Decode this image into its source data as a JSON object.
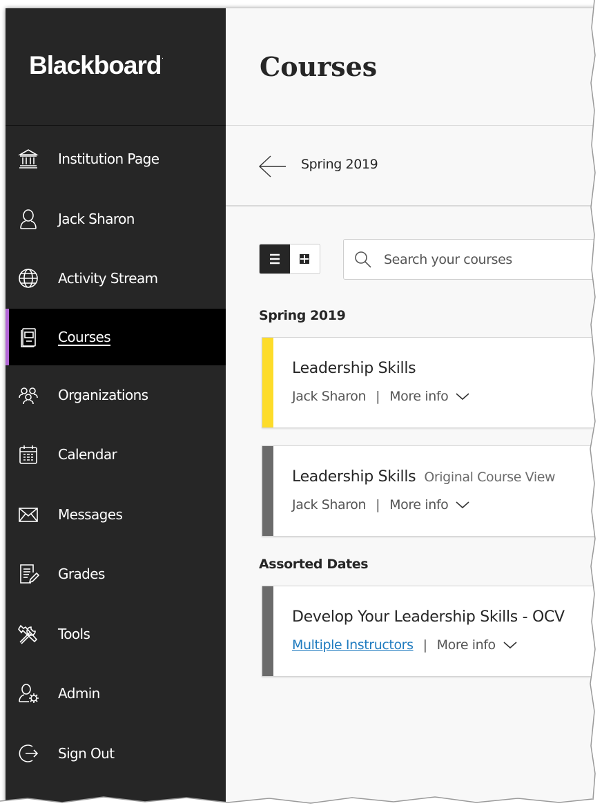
{
  "app": {
    "brand": "Blackboard",
    "trademark": "."
  },
  "colors": {
    "sidebar_bg": "#262626",
    "active_accent": "#b367d6",
    "link": "#1f7bbf",
    "stripe_yellow": "#fddc2a",
    "stripe_gray": "#6b6b6b"
  },
  "sidebar": {
    "items": [
      {
        "label": "Institution Page",
        "icon": "institution-icon"
      },
      {
        "label": "Jack Sharon",
        "icon": "user-icon"
      },
      {
        "label": "Activity Stream",
        "icon": "globe-icon"
      },
      {
        "label": "Courses",
        "icon": "courses-icon",
        "active": true
      },
      {
        "label": "Organizations",
        "icon": "organizations-icon"
      },
      {
        "label": "Calendar",
        "icon": "calendar-icon"
      },
      {
        "label": "Messages",
        "icon": "envelope-icon"
      },
      {
        "label": "Grades",
        "icon": "grades-icon"
      },
      {
        "label": "Tools",
        "icon": "tools-icon"
      },
      {
        "label": "Admin",
        "icon": "admin-icon"
      },
      {
        "label": "Sign Out",
        "icon": "sign-out-icon"
      }
    ]
  },
  "header": {
    "title": "Courses"
  },
  "term": {
    "label": "Spring 2019"
  },
  "search": {
    "placeholder": "Search your courses"
  },
  "groups": [
    {
      "heading": "Spring 2019",
      "courses": [
        {
          "title": "Leadership Skills",
          "subtitle": "",
          "instructor": "Jack Sharon",
          "more": "More info",
          "stripe": "yellow"
        },
        {
          "title": "Leadership Skills",
          "subtitle": "Original Course View",
          "instructor": "Jack Sharon",
          "more": "More info",
          "stripe": "gray"
        }
      ]
    },
    {
      "heading": "Assorted Dates",
      "courses": [
        {
          "title": "Develop Your Leadership Skills - OCV",
          "subtitle": "",
          "instructor": "Multiple Instructors",
          "instructor_is_link": true,
          "more": "More info",
          "stripe": "gray"
        }
      ]
    }
  ]
}
